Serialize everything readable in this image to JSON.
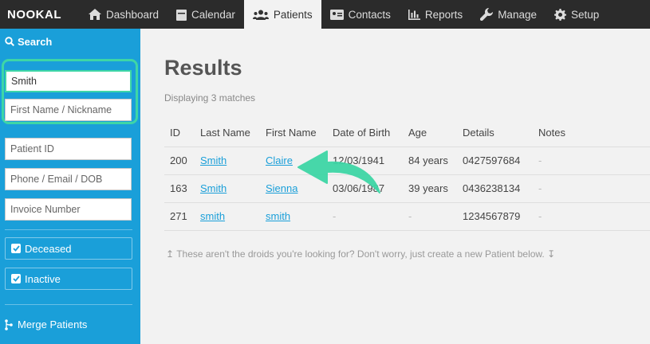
{
  "nav": {
    "logo": "NOOKAL",
    "items": [
      {
        "label": "Dashboard"
      },
      {
        "label": "Calendar"
      },
      {
        "label": "Patients"
      },
      {
        "label": "Contacts"
      },
      {
        "label": "Reports"
      },
      {
        "label": "Manage"
      },
      {
        "label": "Setup"
      }
    ]
  },
  "sidebar": {
    "heading": "Search",
    "last_name_value": "Smith",
    "first_name_placeholder": "First Name / Nickname",
    "patient_id_placeholder": "Patient ID",
    "contact_placeholder": "Phone / Email / DOB",
    "invoice_placeholder": "Invoice Number",
    "deceased_label": "Deceased",
    "inactive_label": "Inactive",
    "merge_label": "Merge Patients"
  },
  "results": {
    "title": "Results",
    "subtitle": "Displaying 3 matches",
    "columns": [
      "ID",
      "Last Name",
      "First Name",
      "Date of Birth",
      "Age",
      "Details",
      "Notes"
    ],
    "rows": [
      {
        "id": "200",
        "last": "Smith",
        "first": "Claire",
        "dob": "12/03/1941",
        "age": "84 years",
        "details": "0427597684",
        "notes": "-"
      },
      {
        "id": "163",
        "last": "Smith",
        "first": "Sienna",
        "dob": "03/06/1987",
        "age": "39 years",
        "details": "0436238134",
        "notes": "-"
      },
      {
        "id": "271",
        "last": "smith",
        "first": "smith",
        "dob": "-",
        "age": "-",
        "details": "1234567879",
        "notes": "-"
      }
    ],
    "hint": "These aren't the droids you're looking for? Don't worry, just create a new Patient below."
  },
  "colors": {
    "sidebar": "#1a9fd9",
    "highlight": "#3ed6a6",
    "nav": "#2b2b2b"
  }
}
